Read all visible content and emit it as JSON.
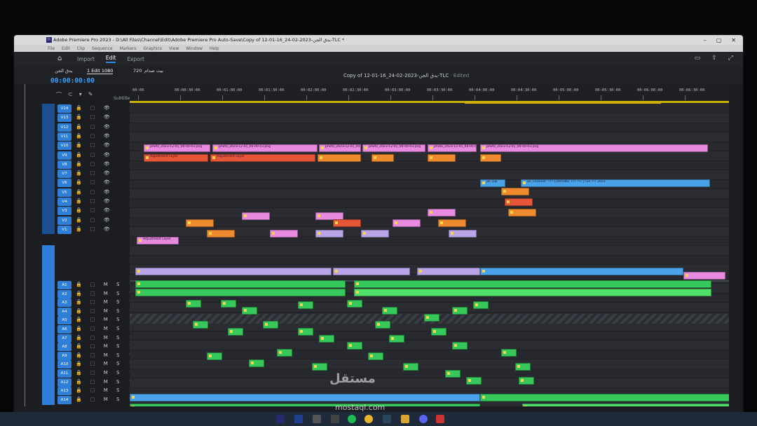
{
  "window": {
    "title": "Adobe Premiere Pro 2023 - D:\\All Files\\Channel\\Edit\\Adobe Premiere Pro Auto-Save\\Copy of 12-01-16_24-02-2023-يدق الجن-TLC *",
    "controls": [
      "–",
      "▢",
      "✕"
    ]
  },
  "menubar": [
    "File",
    "Edit",
    "Clip",
    "Sequence",
    "Markers",
    "Graphics",
    "View",
    "Window",
    "Help"
  ],
  "workspace": {
    "tabs": [
      "Import",
      "Edit",
      "Export"
    ],
    "active": "Edit"
  },
  "sequence": {
    "tab_left": "يدق الجن",
    "tab_second": "1 Edit 1080",
    "tab_third": "720",
    "tab_fourth": "بيت صدام",
    "name": "Copy of 12-01-16_24-02-2023-يدق الجن-TLC",
    "status": "· Edited",
    "timecode": "00:00:00:00",
    "subtitle_label": "Subtitle"
  },
  "ruler": {
    "labels": [
      "00:00",
      "00:00:30:00",
      "00:01:00:00",
      "00:01:30:00",
      "00:02:00:00",
      "00:02:30:00",
      "00:03:00:00",
      "00:03:30:00",
      "00:04:00:00",
      "00:04:30:00",
      "00:05:00:00",
      "00:05:30:00",
      "00:06:00:00",
      "00:06:30:00"
    ]
  },
  "tracks": {
    "video": [
      "V14",
      "V13",
      "V12",
      "V11",
      "V10",
      "V9",
      "V8",
      "V7",
      "V6",
      "V5",
      "V4",
      "V3",
      "V2",
      "V1"
    ],
    "audio": [
      "A1",
      "A2",
      "A3",
      "A4",
      "A5",
      "A6",
      "A7",
      "A8",
      "A9",
      "A10",
      "A11",
      "A12",
      "A13",
      "A14"
    ],
    "video_header_icons": "🔒 ⬚ 👁",
    "audio_header_icons": "🔒 ⬚ M S 🎙"
  },
  "clips": {
    "adjustment_layer": "Adjustment Layer",
    "photo": "photo_2023-12-01_04-00-03.png",
    "dip": "DC Dip",
    "channel": "DC Channel: ??? Cinematic ??? ??? | Full ??? 2023"
  },
  "watermark": {
    "logo": "مستقل",
    "url": "mostaql.com"
  },
  "colors": {
    "accent": "#2d8ceb",
    "clip_pink": "#e88ae0",
    "clip_orange": "#f08a2e",
    "clip_lavender": "#b9a4e8",
    "clip_blue": "#4aa3e8",
    "clip_green": "#36c85a"
  }
}
